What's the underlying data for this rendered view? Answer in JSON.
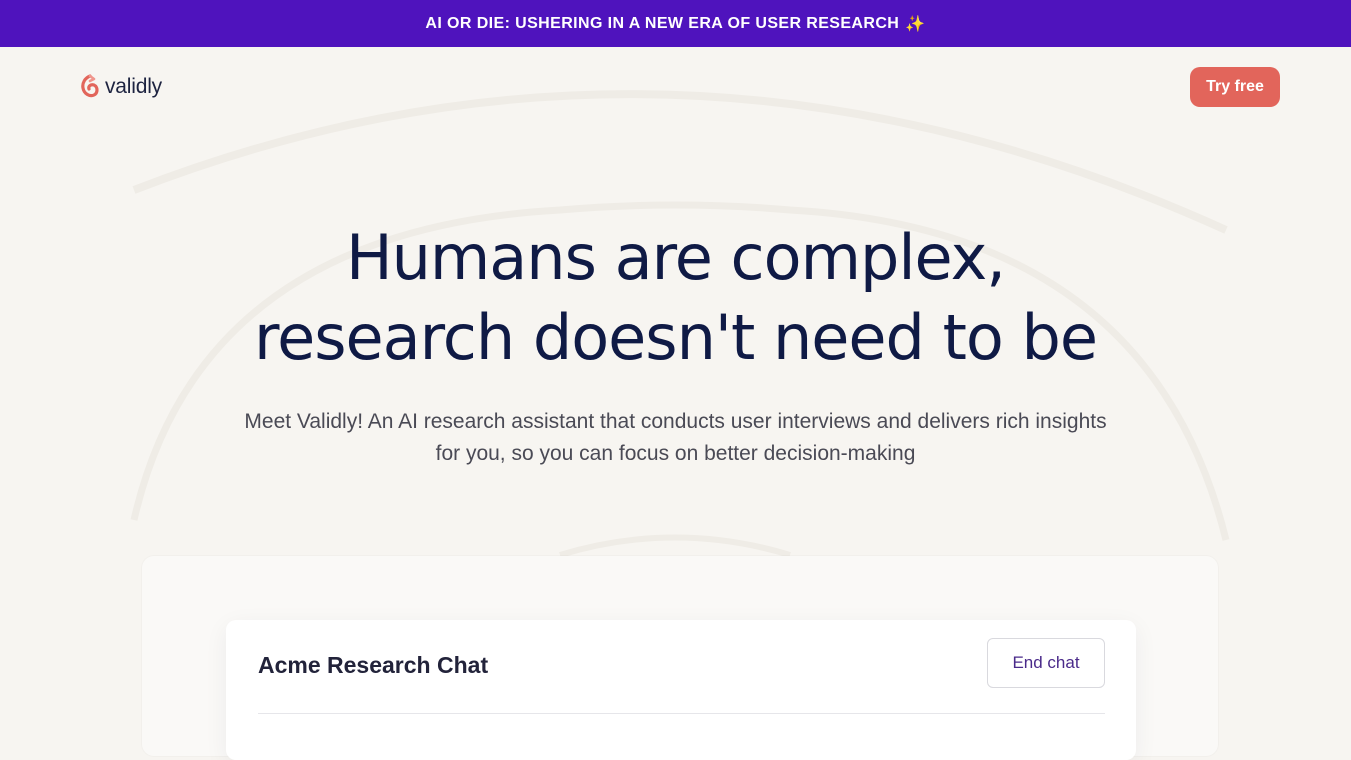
{
  "banner": {
    "text": "AI OR DIE: USHERING IN A NEW ERA OF USER RESEARCH",
    "icon": "sparkle-icon",
    "background": "#4f13bd"
  },
  "nav": {
    "logo_text": "validly",
    "cta_label": "Try free",
    "cta_color": "#e2655b"
  },
  "hero": {
    "title_line1": "Humans are complex,",
    "title_line2": "research doesn't need to be",
    "subtitle": "Meet Validly! An AI research assistant that conducts user interviews and delivers rich insights for you, so you can focus on better decision-making"
  },
  "chat": {
    "title": "Acme Research Chat",
    "end_label": "End chat"
  }
}
